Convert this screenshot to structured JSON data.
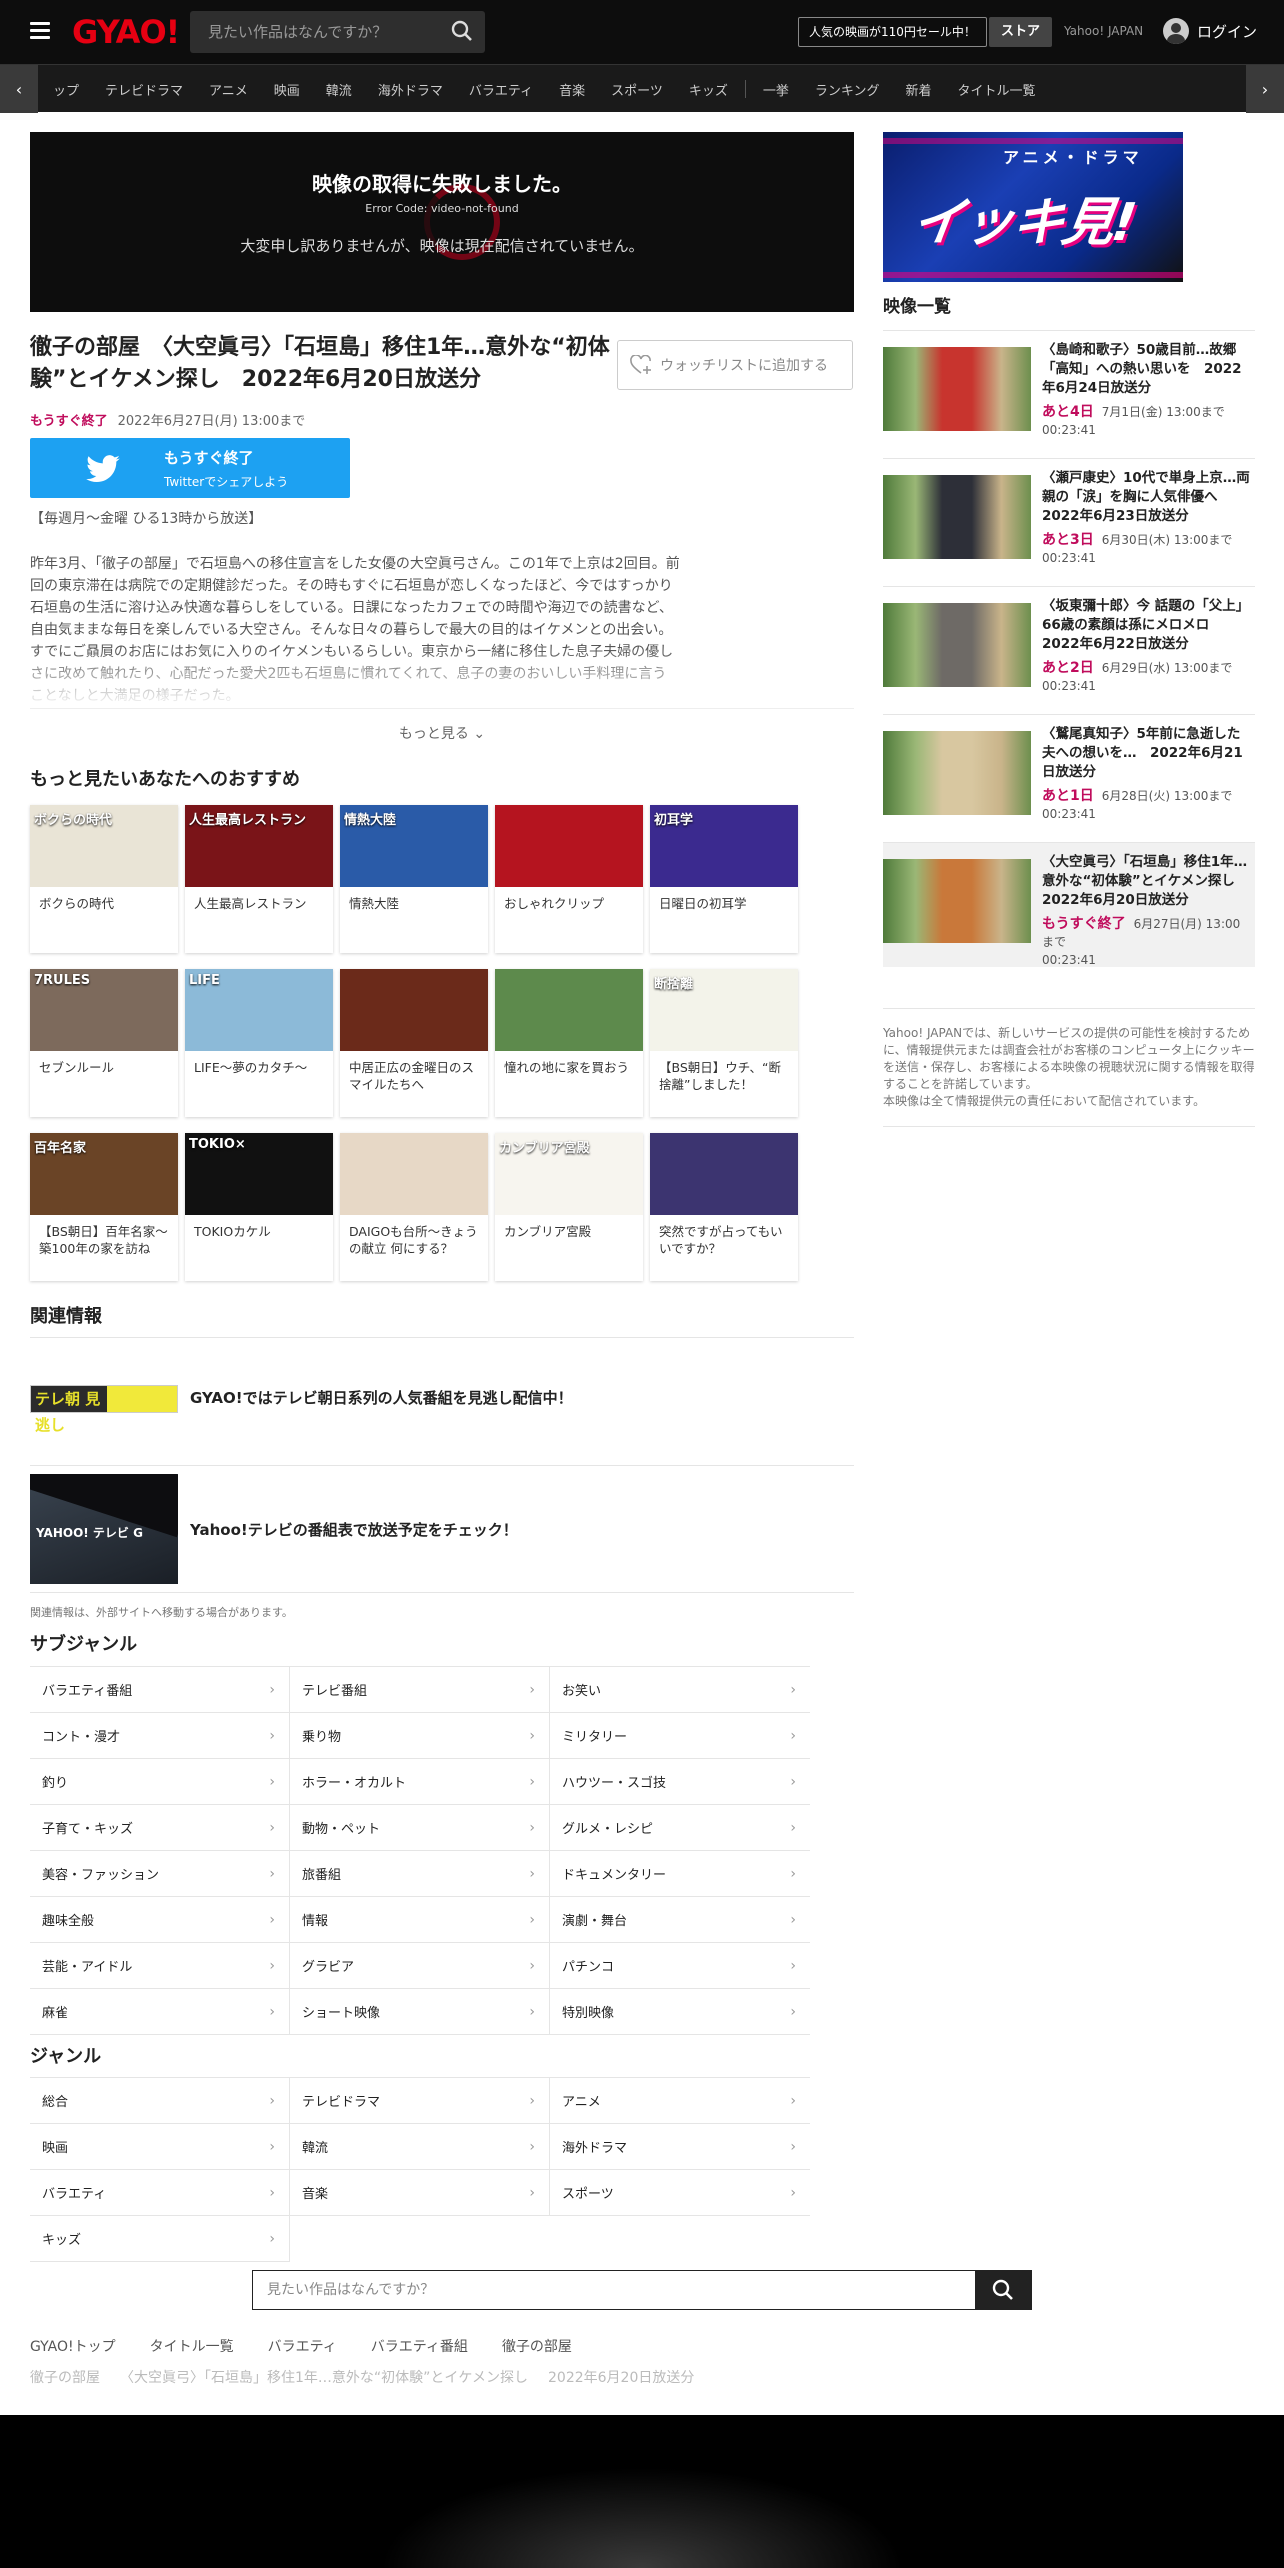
{
  "header": {
    "logo": "GYAO!",
    "search_placeholder": "見たい作品はなんですか？",
    "sale": "人気の映画が110円セール中！",
    "store": "ストア",
    "yahoo": "Yahoo! JAPAN",
    "login": "ログイン"
  },
  "nav": {
    "items": [
      "ップ",
      "テレビドラマ",
      "アニメ",
      "映画",
      "韓流",
      "海外ドラマ",
      "バラエティ",
      "音楽",
      "スポーツ",
      "キッズ"
    ],
    "items2": [
      "一挙",
      "ランキング",
      "新着",
      "タイトル一覧"
    ]
  },
  "player": {
    "error_title": "映像の取得に失敗しました。",
    "error_code": "Error Code: video-not-found",
    "error_msg": "大変申し訳ありませんが、映像は現在配信されていません。"
  },
  "episode": {
    "title": "徹子の部屋　〈大空眞弓〉「石垣島」移住1年…意外な“初体験”とイケメン探し　2022年6月20日放送分",
    "watchlist": "ウォッチリストに追加する",
    "status": "もうすぐ終了",
    "until": "2022年6月27日(月) 13:00まで",
    "twitter_status": "もうすぐ終了",
    "twitter_share": "Twitterでシェアしよう",
    "schedule": "【毎週月～金曜 ひる13時から放送】",
    "description": "昨年3月、「徹子の部屋」で石垣島への移住宣言をした女優の大空眞弓さん。この1年で上京は2回目。前回の東京滞在は病院での定期健診だった。その時もすぐに石垣島が恋しくなったほど、今ではすっかり石垣島の生活に溶け込み快適な暮らしをしている。日課になったカフェでの時間や海辺での読書など、自由気ままな毎日を楽しんでいる大空さん。そんな日々の暮らしで最大の目的はイケメンとの出会い。すでにご贔屓のお店にはお気に入りのイケメンもいるらしい。東京から一緒に移住した息子夫婦の優しさに改めて触れたり、心配だった愛犬2匹も石垣島に慣れてくれて、息子の妻のおいしい手料理に言うことなしと大満足の様子だった。",
    "more": "もっと見る"
  },
  "recommend": {
    "title": "もっと見たいあなたへのおすすめ",
    "items": [
      {
        "label": "ボクらの時代",
        "thumb": "ボクらの時代",
        "bg": "#e9e4d6"
      },
      {
        "label": "人生最高レストラン",
        "thumb": "人生最高レストラン",
        "bg": "#7a1418"
      },
      {
        "label": "情熱大陸",
        "thumb": "情熱大陸",
        "bg": "#2a5ba8"
      },
      {
        "label": "おしゃれクリップ",
        "thumb": "",
        "bg": "#b5141f"
      },
      {
        "label": "日曜日の初耳学",
        "thumb": "初耳学",
        "bg": "#3b2a8f"
      },
      {
        "label": "セブンルール",
        "thumb": "7RULES",
        "bg": "#7d6a5c"
      },
      {
        "label": "LIFE～夢のカタチ～",
        "thumb": "LIFE",
        "bg": "#8cbad8"
      },
      {
        "label": "中居正広の金曜日のスマイルたちへ",
        "thumb": "",
        "bg": "#6b2a1a"
      },
      {
        "label": "憧れの地に家を買おう",
        "thumb": "",
        "bg": "#5d8a4c"
      },
      {
        "label": "【BS朝日】ウチ、“断捨離”しました！",
        "thumb": "断捨離",
        "bg": "#f3f3ea"
      },
      {
        "label": "【BS朝日】百年名家～築100年の家を訪ね",
        "thumb": "百年名家",
        "bg": "#6a4426"
      },
      {
        "label": "TOKIOカケル",
        "thumb": "TOKIO×",
        "bg": "#111111"
      },
      {
        "label": "DAIGOも台所～きょうの献立 何にする？",
        "thumb": "",
        "bg": "#e7d8c6"
      },
      {
        "label": "カンブリア宮殿",
        "thumb": "カンブリア宮殿",
        "bg": "#f7f5ef"
      },
      {
        "label": "突然ですが占ってもいいですか？",
        "thumb": "",
        "bg": "#3c3470"
      }
    ]
  },
  "related": {
    "title": "関連情報",
    "items": [
      {
        "text": "GYAO!ではテレビ朝日系列の人気番組を見逃し配信中！",
        "thumb": "テレ朝 見逃し"
      },
      {
        "text": "Yahoo!テレビの番組表で放送予定をチェック！",
        "thumb": "YAHOO! テレビ G"
      }
    ],
    "note": "関連情報は、外部サイトへ移動する場合があります。"
  },
  "subgenre": {
    "title": "サブジャンル",
    "items": [
      "バラエティ番組",
      "テレビ番組",
      "お笑い",
      "コント・漫才",
      "乗り物",
      "ミリタリー",
      "釣り",
      "ホラー・オカルト",
      "ハウツー・スゴ技",
      "子育て・キッズ",
      "動物・ペット",
      "グルメ・レシピ",
      "美容・ファッション",
      "旅番組",
      "ドキュメンタリー",
      "趣味全般",
      "情報",
      "演劇・舞台",
      "芸能・アイドル",
      "グラビア",
      "パチンコ",
      "麻雀",
      "ショート映像",
      "特別映像"
    ]
  },
  "genre": {
    "title": "ジャンル",
    "items": [
      "総合",
      "テレビドラマ",
      "アニメ",
      "映画",
      "韓流",
      "海外ドラマ",
      "バラエティ",
      "音楽",
      "スポーツ",
      "キッズ"
    ]
  },
  "footer": {
    "search_placeholder": "見たい作品はなんですか？",
    "breadcrumb": [
      "GYAO!トップ",
      "タイトル一覧",
      "バラエティ",
      "バラエティ番組",
      "徹子の部屋"
    ],
    "current": [
      "徹子の部屋",
      "〈大空眞弓〉「石垣島」移住1年…意外な“初体験”とイケメン探し",
      "2022年6月20日放送分"
    ]
  },
  "side": {
    "banner_top": "アニメ・ドラマ",
    "banner_main": "イッキ見!",
    "list_title": "映像一覧",
    "videos": [
      {
        "title": "〈島崎和歌子〉50歳目前…故郷「高知」への熱い思いを　2022年6月24日放送分",
        "remain": "あと4日",
        "until": "7月1日(金) 13:00まで",
        "dur": "00:23:41",
        "bg": "#c8342e"
      },
      {
        "title": "〈瀬戸康史〉10代で単身上京…両親の「涙」を胸に人気俳優へ　2022年6月23日放送分",
        "remain": "あと3日",
        "until": "6月30日(木) 13:00まで",
        "dur": "00:23:41",
        "bg": "#2d2f38"
      },
      {
        "title": "〈坂東彌十郎〉今 話題の「父上」66歳の素顔は孫にメロメロ　2022年6月22日放送分",
        "remain": "あと2日",
        "until": "6月29日(水) 13:00まで",
        "dur": "00:23:41",
        "bg": "#6e6a66"
      },
      {
        "title": "〈鷲尾真知子〉5年前に急逝した夫への想いを…　2022年6月21日放送分",
        "remain": "あと1日",
        "until": "6月28日(火) 13:00まで",
        "dur": "00:23:41",
        "bg": "#d8c7a0"
      },
      {
        "title": "〈大空眞弓〉「石垣島」移住1年…意外な“初体験”とイケメン探し　2022年6月20日放送分",
        "remain": "もうすぐ終了",
        "until": "6月27日(月) 13:00まで",
        "dur": "00:23:41",
        "bg": "#c9783a"
      }
    ],
    "disclaimer1": "Yahoo! JAPANでは、新しいサービスの提供の可能性を検討するために、情報提供元または調査会社がお客様のコンピュータ上にクッキーを送信・保存し、お客様による本映像の視聴状況に関する情報を取得することを許諾しています。",
    "disclaimer2": "本映像は全て情報提供元の責任において配信されています。"
  }
}
